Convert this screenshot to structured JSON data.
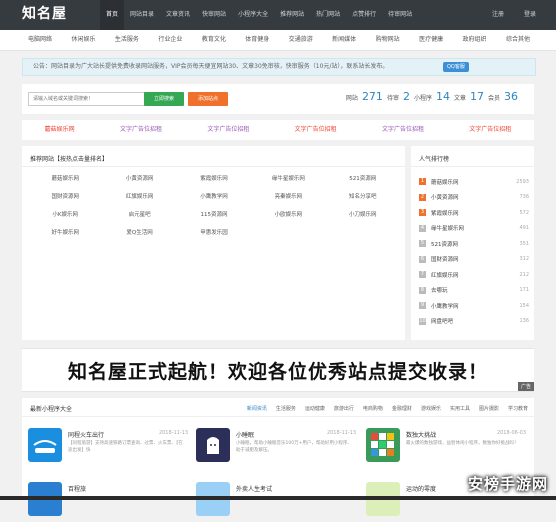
{
  "brand": {
    "logo": "知名屋"
  },
  "top_menu": [
    "首页",
    "网站目录",
    "文章资讯",
    "快审网站",
    "小程序大全",
    "推荐网站",
    "热门网站",
    "点赞排行",
    "待审网站"
  ],
  "auth": {
    "register": "注册",
    "login": "登录"
  },
  "categories": [
    "电脑网络",
    "休闲娱乐",
    "生活服务",
    "行业企业",
    "教育文化",
    "体育健身",
    "交通旅游",
    "新闻媒体",
    "购物网站",
    "医疗健康",
    "政府组织",
    "综合其他"
  ],
  "notice": {
    "text": "公告：网站目录为广大站长提供免费收录网站服务，VIP会员每天便宜网站30、文章30免审核，快审服务（10元/站），联系站长发布。",
    "qq_label": "QQ客服"
  },
  "search": {
    "placeholder": "请输入域名或关键词搜索！",
    "search_button": "立即搜索",
    "submit_button": "添加站点"
  },
  "stats": [
    {
      "label": "网站",
      "value": "271"
    },
    {
      "label": "待审",
      "value": "2"
    },
    {
      "label": "小程序",
      "value": "14"
    },
    {
      "label": "文章",
      "value": "17"
    },
    {
      "label": "会员",
      "value": "36"
    }
  ],
  "ad_links": [
    "蘑菇娱乐网",
    "文字广告位招租",
    "文字广告位招租",
    "文字广告位招租",
    "文字广告位招租",
    "文字广告位招租"
  ],
  "recommend": {
    "title": "推荐网站【按热点击量排名】",
    "sites": [
      "蘑菇娱乐网",
      "小黄资源网",
      "紫霞娱乐网",
      "缘牛星娱乐网",
      "521资源网",
      "国财资源网",
      "红旗娱乐网",
      "小鹰教学网",
      "亮秦娱乐网",
      "知名分享吧",
      "小K娱乐网",
      "启元星吧",
      "115资源网",
      "小欧娱乐网",
      "小刀娱乐网",
      "好牛娱乐网",
      "爱Q生活网",
      "甲惠发乐园",
      "",
      ""
    ]
  },
  "ranking": {
    "title": "人气排行榜",
    "items": [
      {
        "rank": "1",
        "name": "蘑菇娱乐网",
        "count": "2593"
      },
      {
        "rank": "2",
        "name": "小黄资源网",
        "count": "736"
      },
      {
        "rank": "3",
        "name": "紫霞娱乐网",
        "count": "572"
      },
      {
        "rank": "4",
        "name": "缘牛星娱乐网",
        "count": "491"
      },
      {
        "rank": "5",
        "name": "521资源网",
        "count": "351"
      },
      {
        "rank": "6",
        "name": "国财资源网",
        "count": "312"
      },
      {
        "rank": "7",
        "name": "红旗娱乐网",
        "count": "212"
      },
      {
        "rank": "8",
        "name": "去哪玩",
        "count": "171"
      },
      {
        "rank": "9",
        "name": "小鹰教学网",
        "count": "154"
      },
      {
        "rank": "10",
        "name": "网盘吧吧",
        "count": "136"
      }
    ]
  },
  "banner": {
    "text": "知名屋正式起航！欢迎各位优秀站点提交收录！",
    "ad_tag": "广告"
  },
  "miniapps": {
    "title": "最新小程序大全",
    "tabs": [
      "新闻资讯",
      "生活服务",
      "运动健康",
      "旅游出行",
      "电商购物",
      "金融理财",
      "游戏娱乐",
      "实用工具",
      "图片摄影",
      "学习教育"
    ],
    "cards": [
      {
        "name": "同程火车出行",
        "date": "2018-11-13",
        "desc": "【同程旅游】支持高速铁路订票查询、过票、火车票、【在途出发】快"
      },
      {
        "name": "小睡眠",
        "date": "2018-11-13",
        "desc": "小睡眠，帮助小睡眠音乐100万+用户，帮助好用小程序、助于减肥及解压。"
      },
      {
        "name": "数独大挑战",
        "date": "2018-06-03",
        "desc": "最火爆的数独游戏，益智休闲小程序，数独你好挑战吗！"
      },
      {
        "name": "百程旅",
        "date": "",
        "desc": ""
      },
      {
        "name": "外卖人生考试",
        "date": "",
        "desc": ""
      },
      {
        "name": "运动的零度",
        "date": "",
        "desc": ""
      }
    ]
  },
  "watermark": "安榜手游网",
  "colors": {
    "nav_bg": "#363b40",
    "accent_blue": "#2e86c1",
    "search_green": "#34a853",
    "submit_orange": "#f0712b",
    "ad_red": "#ee4433",
    "ad_purple": "#9b59b6"
  }
}
